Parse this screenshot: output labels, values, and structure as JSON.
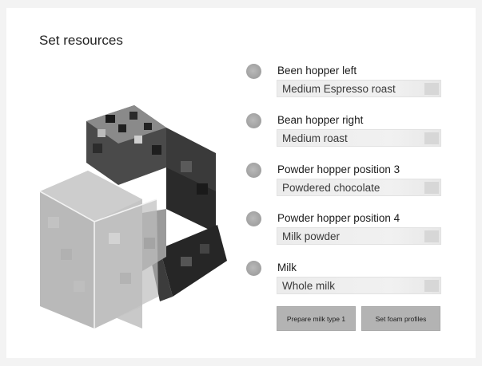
{
  "page": {
    "title": "Set resources"
  },
  "machine_icon": "coffee-machine-illustration",
  "resources": [
    {
      "label": "Been hopper left",
      "value": "Medium Espresso roast"
    },
    {
      "label": "Bean hopper right",
      "value": "Medium roast"
    },
    {
      "label": "Powder hopper position 3",
      "value": "Powdered chocolate"
    },
    {
      "label": "Powder hopper position 4",
      "value": "Milk powder"
    },
    {
      "label": "Milk",
      "value": "Whole milk"
    }
  ],
  "actions": {
    "prepare_milk_label": "Prepare milk type 1",
    "foam_profiles_label": "Set foam profiles"
  },
  "colors": {
    "background": "#f3f3f3",
    "panel": "#ffffff",
    "button": "#b3b3b3",
    "indicator": "#a3a3a3"
  }
}
